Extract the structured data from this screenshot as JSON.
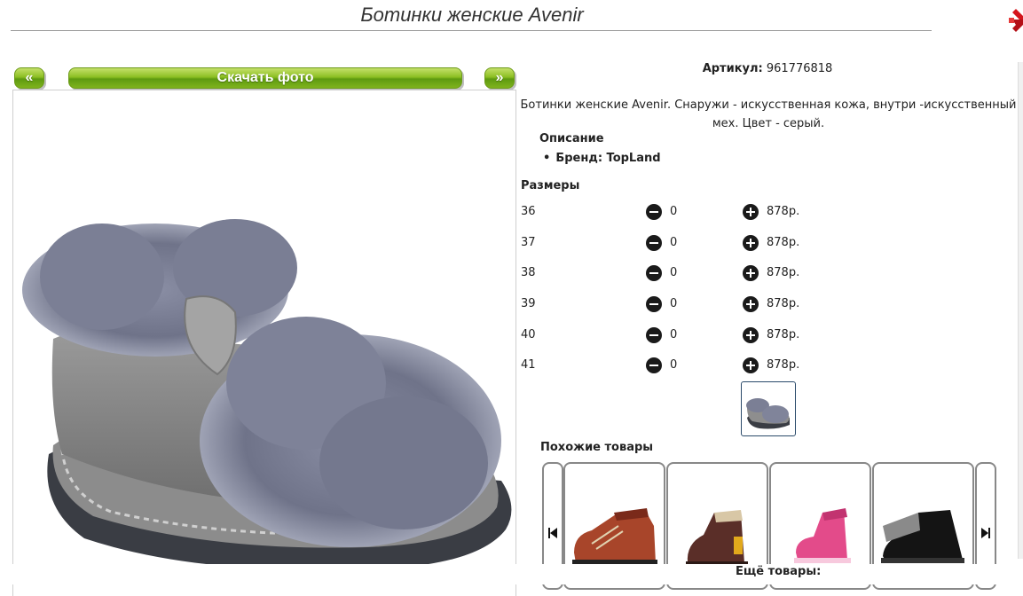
{
  "page": {
    "title": "Ботинки женские Avenir"
  },
  "gallery": {
    "prev_label": "«",
    "download_label": "Скачать фото",
    "next_label": "»"
  },
  "product": {
    "article_label": "Артикул:",
    "article_value": "961776818",
    "description": "Ботинки женские Avenir. Снаружи - искусственная кожа, внутри -искусственный мех. Цвет - серый.",
    "description_heading": "Описание",
    "brand_line": "Бренд: TopLand",
    "sizes_heading": "Размеры",
    "sizes": [
      {
        "size": "36",
        "qty": "0",
        "price": "878р."
      },
      {
        "size": "37",
        "qty": "0",
        "price": "878р."
      },
      {
        "size": "38",
        "qty": "0",
        "price": "878р."
      },
      {
        "size": "39",
        "qty": "0",
        "price": "878р."
      },
      {
        "size": "40",
        "qty": "0",
        "price": "878р."
      },
      {
        "size": "41",
        "qty": "0",
        "price": "878р."
      }
    ]
  },
  "similar": {
    "heading": "Похожие товары",
    "more_label": "Ещё товары:"
  },
  "icons": {
    "close": "close-x-icon",
    "minus": "minus-circle-icon",
    "plus": "plus-circle-icon",
    "prev": "skip-prev-icon",
    "next": "skip-next-icon"
  },
  "colors": {
    "accent_green": "#7fb31d",
    "close_red": "#d4141c"
  }
}
